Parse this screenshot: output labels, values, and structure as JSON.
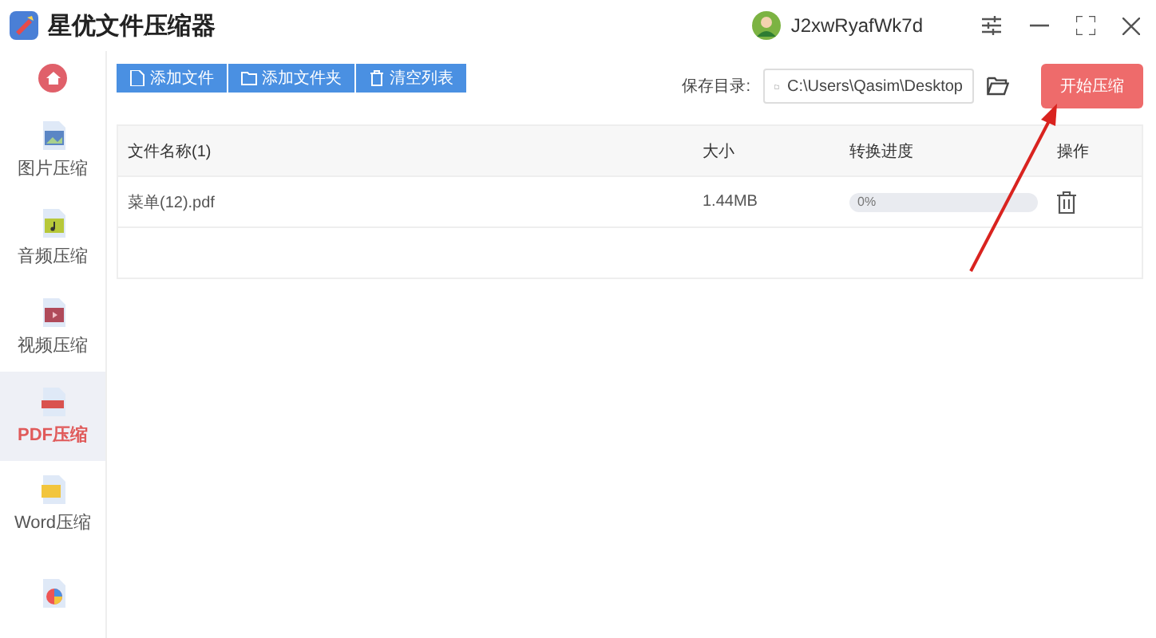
{
  "window": {
    "title": "星优文件压缩器",
    "user": "J2xwRyafWk7d"
  },
  "sidebar": {
    "items": [
      {
        "kind": "home",
        "selected": false
      },
      {
        "kind": "image",
        "label": "图片压缩",
        "selected": false
      },
      {
        "kind": "audio",
        "label": "音频压缩",
        "selected": false
      },
      {
        "kind": "video",
        "label": "视频压缩",
        "selected": false
      },
      {
        "kind": "pdf",
        "label": "PDF压缩",
        "selected": true
      },
      {
        "kind": "word",
        "label": "Word压缩",
        "selected": false
      },
      {
        "kind": "chart",
        "selected": false
      }
    ]
  },
  "toolbar": {
    "buttons": [
      {
        "kind": "file",
        "label": "添加文件"
      },
      {
        "kind": "folder",
        "label": "添加文件夹"
      },
      {
        "kind": "trash",
        "label": "清空列表"
      }
    ],
    "save_label": "保存目录:",
    "save_path": "C:\\Users\\Qasim\\Desktop",
    "start_button": "开始压缩"
  },
  "table": {
    "columns": [
      "文件名称(1)",
      "大小",
      "转换进度",
      "操作"
    ],
    "rows": [
      {
        "name": "菜单(12).pdf",
        "size": "1.44MB",
        "level": 0,
        "reading": "0%"
      }
    ]
  }
}
